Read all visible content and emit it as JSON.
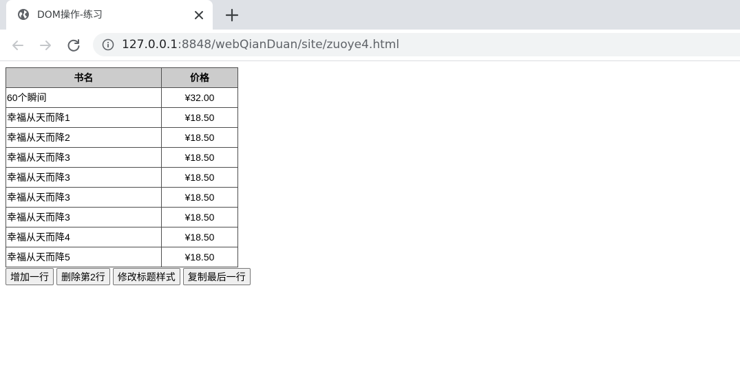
{
  "browser": {
    "tab_title": "DOM操作-练习",
    "url_host": "127.0.0.1",
    "url_rest": ":8848/webQianDuan/site/zuoye4.html"
  },
  "table": {
    "headers": [
      "书名",
      "价格"
    ],
    "rows": [
      {
        "name": "60个瞬间",
        "price": "¥32.00"
      },
      {
        "name": "幸福从天而降1",
        "price": "¥18.50"
      },
      {
        "name": "幸福从天而降2",
        "price": "¥18.50"
      },
      {
        "name": "幸福从天而降3",
        "price": "¥18.50"
      },
      {
        "name": "幸福从天而降3",
        "price": "¥18.50"
      },
      {
        "name": "幸福从天而降3",
        "price": "¥18.50"
      },
      {
        "name": "幸福从天而降3",
        "price": "¥18.50"
      },
      {
        "name": "幸福从天而降4",
        "price": "¥18.50"
      },
      {
        "name": "幸福从天而降5",
        "price": "¥18.50"
      }
    ]
  },
  "buttons": {
    "add_row": "增加一行",
    "delete_row2": "删除第2行",
    "modify_header_style": "修改标题样式",
    "copy_last_row": "复制最后一行"
  }
}
